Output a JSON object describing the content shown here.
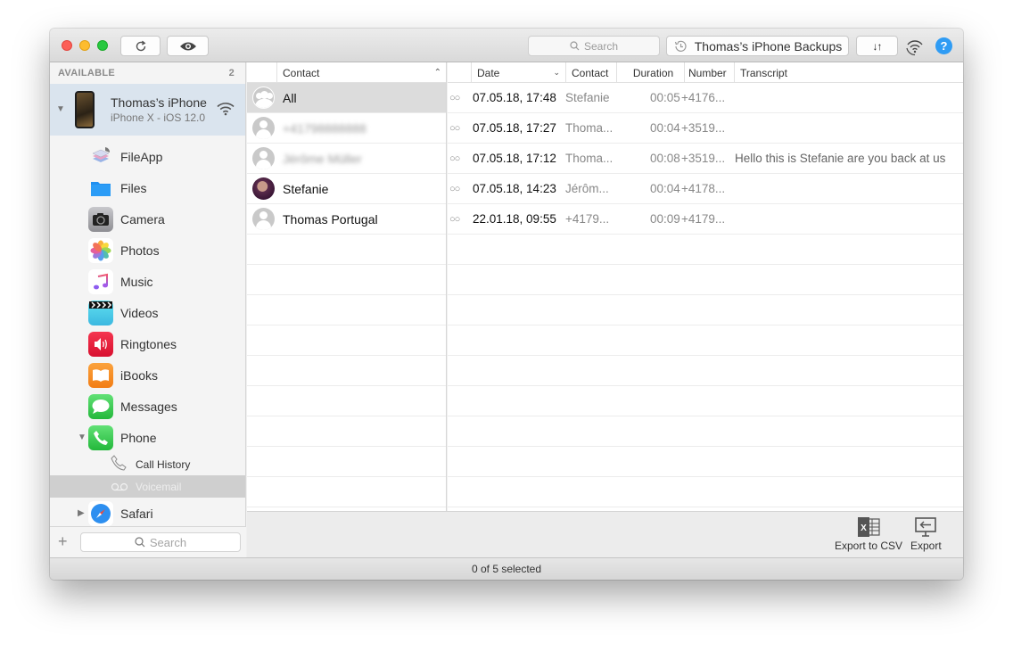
{
  "window": {
    "toolbar": {
      "refresh_icon": "refresh-icon",
      "preview_icon": "eye-icon",
      "search_placeholder": "Search",
      "backups_label": "Thomas’s iPhone Backups",
      "transfer_label": "↓↑",
      "help_label": "?"
    },
    "sidebar": {
      "section_title": "AVAILABLE",
      "section_count": "2",
      "device": {
        "name": "Thomas’s iPhone",
        "subtitle": "iPhone X - iOS 12.0"
      },
      "items": [
        {
          "label": "FileApp",
          "icon": "fileapp-icon",
          "color": "#e8e8ef"
        },
        {
          "label": "Files",
          "icon": "files-icon",
          "color": "#ffffff"
        },
        {
          "label": "Camera",
          "icon": "camera-icon",
          "color": "#8e8e93"
        },
        {
          "label": "Photos",
          "icon": "photos-icon",
          "color": "#ffffff"
        },
        {
          "label": "Music",
          "icon": "music-icon",
          "color": "#ffffff"
        },
        {
          "label": "Videos",
          "icon": "videos-icon",
          "color": "#4fd2e8"
        },
        {
          "label": "Ringtones",
          "icon": "ringtones-icon",
          "color": "#e5213d"
        },
        {
          "label": "iBooks",
          "icon": "ibooks-icon",
          "color": "#f7891f"
        },
        {
          "label": "Messages",
          "icon": "messages-icon",
          "color": "#35c94a"
        },
        {
          "label": "Phone",
          "icon": "phone-icon",
          "color": "#35c94a"
        }
      ],
      "phone_children": [
        {
          "label": "Call History",
          "icon": "call-history-icon"
        },
        {
          "label": "Voicemail",
          "icon": "voicemail-icon",
          "selected": true
        }
      ],
      "after_items": [
        {
          "label": "Safari",
          "icon": "safari-icon",
          "color": "#2d8ff0"
        }
      ],
      "search_placeholder": "Search",
      "add_label": "+"
    },
    "contacts": {
      "header": "Contact",
      "rows": [
        {
          "name": "All",
          "avatar": "group",
          "selected": true
        },
        {
          "name": "+41798888888",
          "avatar": "default",
          "blurred": true
        },
        {
          "name": "Jérôme Müller",
          "avatar": "default",
          "blurred": true
        },
        {
          "name": "Stefanie",
          "avatar": "photo"
        },
        {
          "name": "Thomas Portugal",
          "avatar": "default"
        }
      ]
    },
    "voicemails": {
      "columns": [
        "Date",
        "Contact",
        "Duration",
        "Number",
        "Transcript"
      ],
      "rows": [
        {
          "date": "07.05.18, 17:48",
          "contact": "Stefanie",
          "duration": "00:05",
          "number": "+4176...",
          "transcript": ""
        },
        {
          "date": "07.05.18, 17:27",
          "contact": "Thoma...",
          "duration": "00:04",
          "number": "+3519...",
          "transcript": ""
        },
        {
          "date": "07.05.18, 17:12",
          "contact": "Thoma...",
          "duration": "00:08",
          "number": "+3519...",
          "transcript": "Hello this is Stefanie are you back at us"
        },
        {
          "date": "07.05.18, 14:23",
          "contact": "Jérôm...",
          "duration": "00:04",
          "number": "+4178...",
          "transcript": ""
        },
        {
          "date": "22.01.18, 09:55",
          "contact": "+4179...",
          "duration": "00:09",
          "number": "+4179...",
          "transcript": ""
        }
      ],
      "voicemail_glyph": "○○"
    },
    "actions": {
      "export_csv_label": "Export to CSV",
      "export_label": "Export"
    },
    "status": "0 of 5 selected"
  }
}
